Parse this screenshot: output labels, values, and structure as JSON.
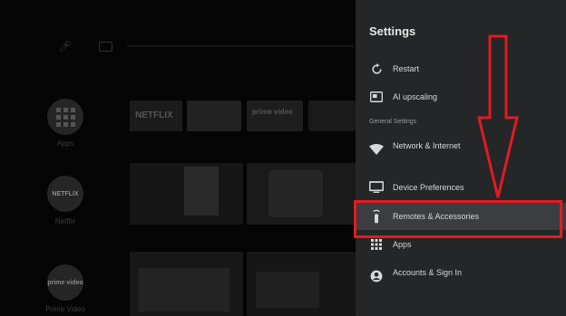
{
  "background": {
    "side": [
      {
        "label": "Apps",
        "icon": "apps-grid-icon"
      },
      {
        "label": "Netflix",
        "text": "NETFLIX"
      },
      {
        "label": "Prime Video",
        "text": "prime video"
      }
    ],
    "tiles": {
      "netflix": "NETFLIX",
      "prime": "prime video"
    }
  },
  "panel": {
    "title": "Settings",
    "items": [
      {
        "label": "Restart",
        "icon": "restart-icon"
      },
      {
        "label": "AI upscaling",
        "icon": "ai-upscaling-icon"
      }
    ],
    "section": "General Settings",
    "general": [
      {
        "label": "Network & Internet",
        "icon": "wifi-icon"
      },
      {
        "label": "Device Preferences",
        "icon": "tv-icon"
      },
      {
        "label": "Remotes & Accessories",
        "icon": "remote-icon"
      },
      {
        "label": "Apps",
        "icon": "apps-icon"
      },
      {
        "label": "Accounts & Sign In",
        "icon": "account-icon"
      }
    ]
  },
  "annotation": {
    "color": "#e21b22"
  }
}
